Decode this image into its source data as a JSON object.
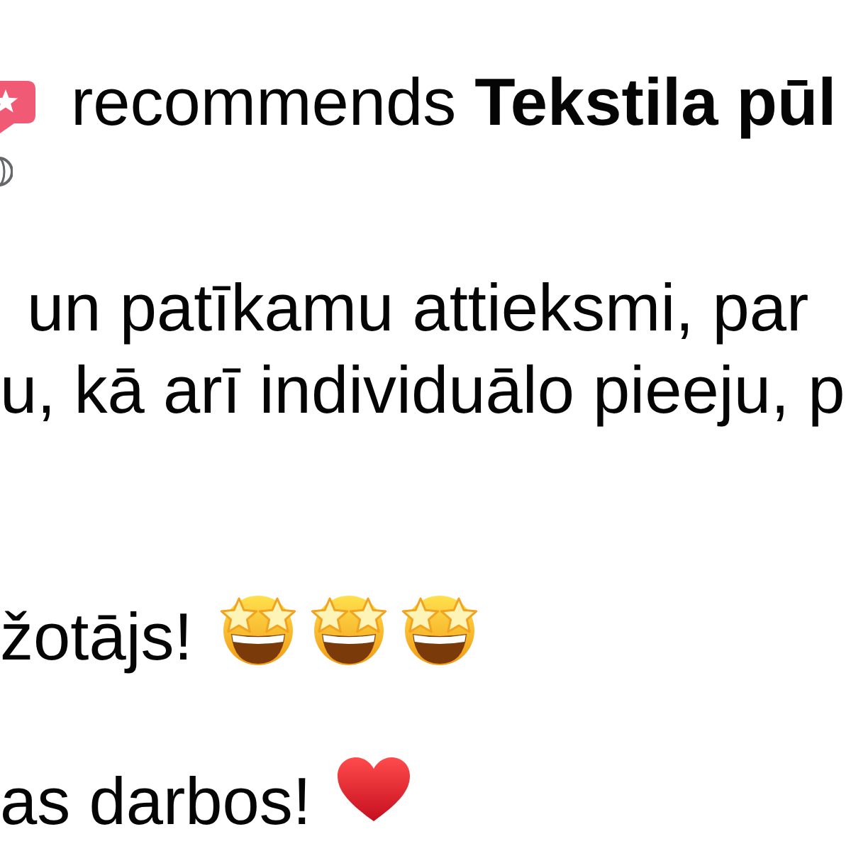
{
  "recommendation": {
    "action": "recommends",
    "page_name": "Tekstila pūl"
  },
  "paragraphs": [
    {
      "lines": [
        "un patīkamu attieksmi, par",
        "u, kā arī individuālo pieeju, p"
      ]
    },
    {
      "lines": [
        "žotājs!"
      ],
      "emoji": [
        {
          "kind": "star_struck"
        },
        {
          "kind": "star_struck"
        },
        {
          "kind": "star_struck"
        }
      ]
    },
    {
      "lines": [
        "as darbos!"
      ],
      "emoji": [
        {
          "kind": "red_heart"
        }
      ]
    }
  ]
}
